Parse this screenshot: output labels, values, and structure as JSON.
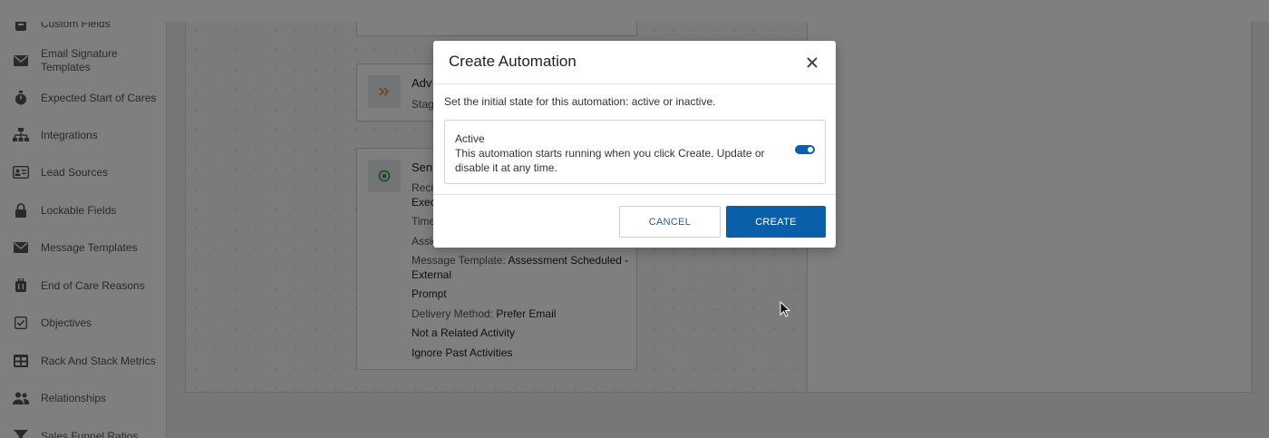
{
  "sidebar": {
    "items": [
      {
        "label": "Custom Fields",
        "icon": "clipboard-icon"
      },
      {
        "label": "Email Signature Templates",
        "icon": "envelope-icon"
      },
      {
        "label": "Expected Start of Cares",
        "icon": "stopwatch-icon"
      },
      {
        "label": "Integrations",
        "icon": "network-icon"
      },
      {
        "label": "Lead Sources",
        "icon": "id-card-icon"
      },
      {
        "label": "Lockable Fields",
        "icon": "lock-icon"
      },
      {
        "label": "Message Templates",
        "icon": "envelope-icon"
      },
      {
        "label": "End of Care Reasons",
        "icon": "luggage-icon"
      },
      {
        "label": "Objectives",
        "icon": "checkbox-icon"
      },
      {
        "label": "Rack And Stack Metrics",
        "icon": "table-icon"
      },
      {
        "label": "Relationships",
        "icon": "people-icon"
      },
      {
        "label": "Sales Funnel Ratios",
        "icon": "funnel-icon"
      }
    ]
  },
  "workflow": {
    "advance_card": {
      "title": "Adv",
      "line1": "Stag"
    },
    "send_card": {
      "title": "Sen",
      "recipient_label": "Recip",
      "recipient_value": "Exec",
      "time_label": "Time",
      "assign_label": "Assig",
      "message_template_label": "Message Template:",
      "message_template_value_1": "Assessment Scheduled -",
      "message_template_value_2": "External",
      "prompt": "Prompt",
      "delivery_label": "Delivery Method:",
      "delivery_value": "Prefer Email",
      "related": "Not a Related Activity",
      "ignore": "Ignore Past Activities"
    }
  },
  "dialog": {
    "title": "Create Automation",
    "description": "Set the initial state for this automation: active or inactive.",
    "option_title": "Active",
    "option_text": "This automation starts running when you click Create. Update or disable it at any time.",
    "toggle_on": true,
    "cancel_label": "CANCEL",
    "create_label": "CREATE"
  },
  "colors": {
    "primary": "#0b5ea8",
    "overlay": "rgba(0,0,0,0.5)",
    "advance_icon": "#e08a2c",
    "send_icon": "#2e8b3a"
  }
}
